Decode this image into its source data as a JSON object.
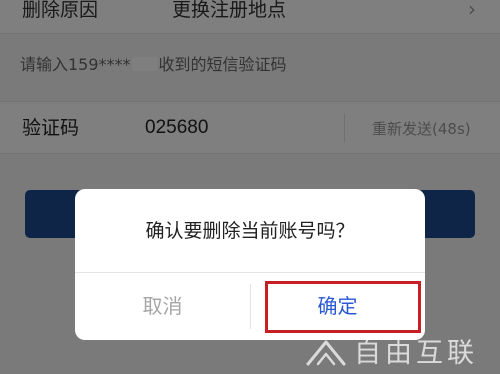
{
  "form": {
    "reason_label": "删除原因",
    "reason_value": "更换注册地点",
    "reason_chevron": "chevron-right-icon",
    "hint_prefix": "请输入159****",
    "hint_suffix": "收到的短信验证码",
    "code_label": "验证码",
    "code_value": "025680",
    "resend_label": "重新发送(48s)"
  },
  "dialog": {
    "message": "确认要删除当前账号吗？",
    "cancel_label": "取消",
    "confirm_label": "确定"
  },
  "watermark": {
    "text": "自由互联"
  },
  "colors": {
    "primary_button": "#1e4a8f",
    "confirm_text": "#2a58d4",
    "highlight_border": "#c72024",
    "overlay": "rgba(0,0,0,0.5)"
  }
}
